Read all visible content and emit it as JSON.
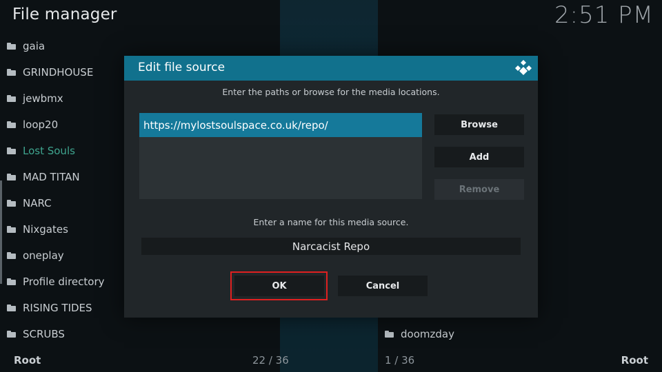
{
  "header": {
    "title": "File manager",
    "clock": "2:51 PM"
  },
  "left_list": {
    "items": [
      {
        "label": "gaia",
        "active": false
      },
      {
        "label": "GRINDHOUSE",
        "active": false
      },
      {
        "label": "jewbmx",
        "active": false
      },
      {
        "label": "loop20",
        "active": false
      },
      {
        "label": "Lost Souls",
        "active": true
      },
      {
        "label": "MAD TITAN",
        "active": false
      },
      {
        "label": "NARC",
        "active": false
      },
      {
        "label": "Nixgates",
        "active": false
      },
      {
        "label": "oneplay",
        "active": false
      },
      {
        "label": "Profile directory",
        "active": false
      },
      {
        "label": "RISING TIDES",
        "active": false
      },
      {
        "label": "SCRUBS",
        "active": false
      }
    ]
  },
  "right_list": {
    "items": [
      {
        "label": "doomzday"
      }
    ]
  },
  "footer": {
    "left_root": "Root",
    "left_count": "22 / 36",
    "right_count": "1 / 36",
    "right_root": "Root"
  },
  "dialog": {
    "title": "Edit file source",
    "paths_hint": "Enter the paths or browse for the media locations.",
    "paths": [
      "https://mylostsoulspace.co.uk/repo/"
    ],
    "browse_label": "Browse",
    "add_label": "Add",
    "remove_label": "Remove",
    "name_hint": "Enter a name for this media source.",
    "name_value": "Narcacist Repo",
    "ok_label": "OK",
    "cancel_label": "Cancel"
  },
  "colors": {
    "accent": "#11718d",
    "selected_row": "#15799a",
    "active_item": "#3fa58f",
    "highlight_box": "#e02020"
  }
}
